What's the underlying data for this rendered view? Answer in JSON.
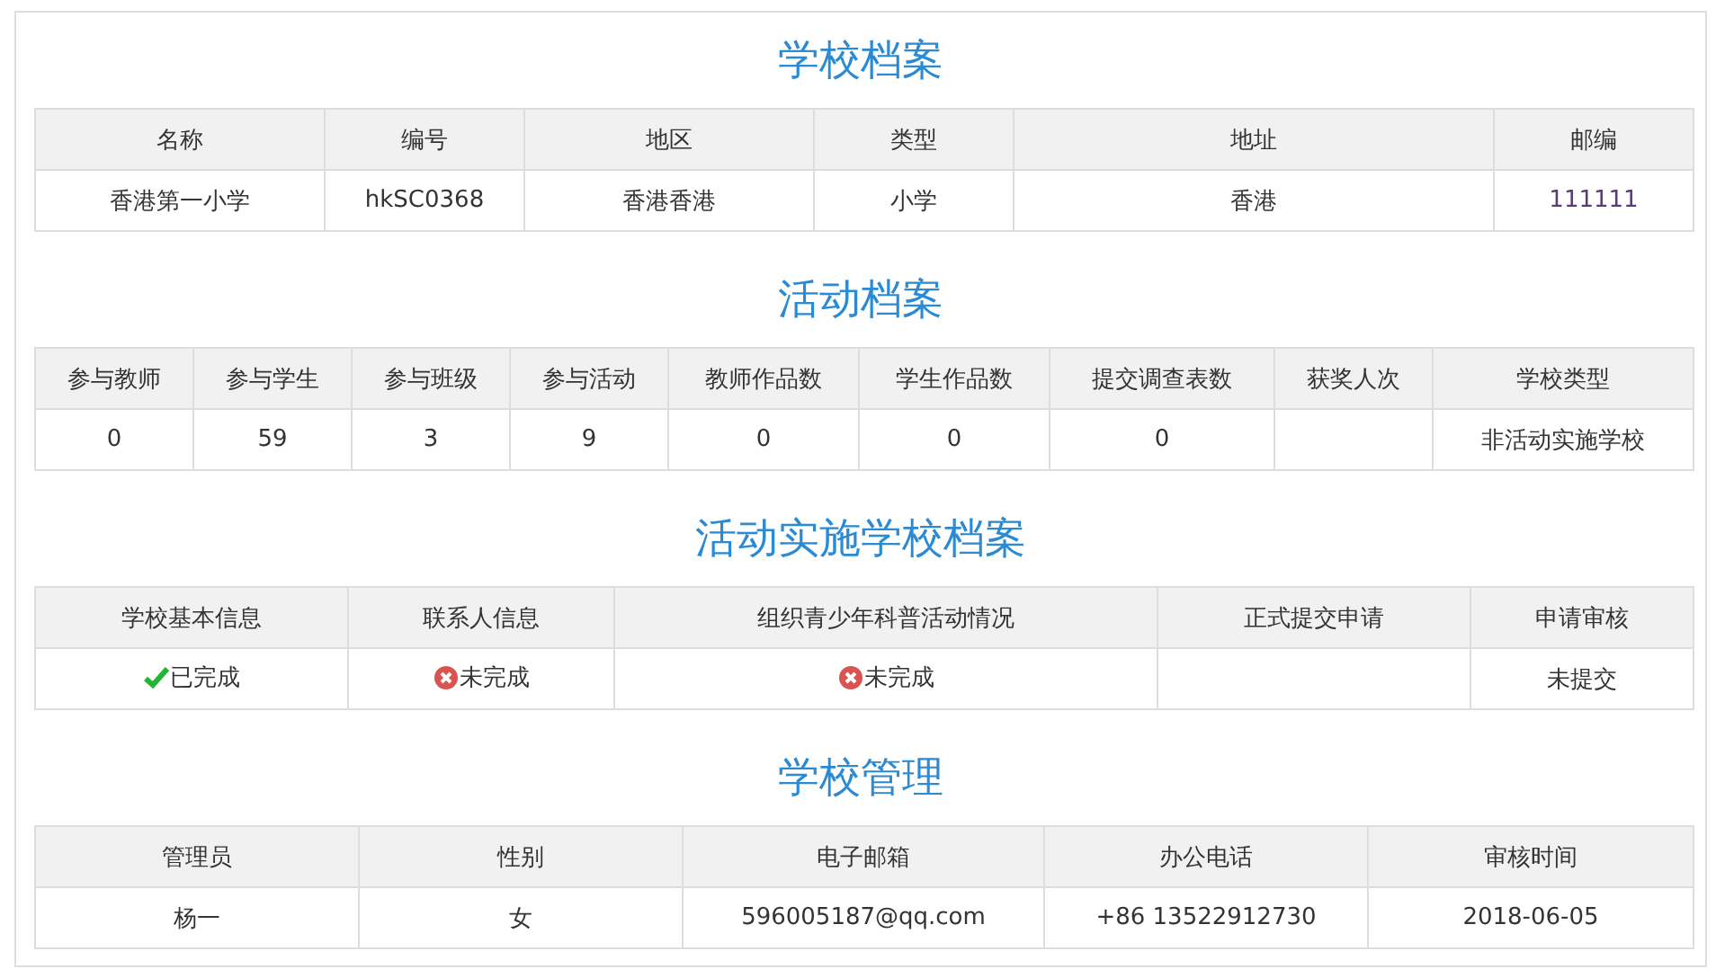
{
  "sections": [
    {
      "title": "学校档案",
      "columns": [
        "名称",
        "编号",
        "地区",
        "类型",
        "地址",
        "邮编"
      ],
      "rows": [
        [
          {
            "text": "香港第一小学"
          },
          {
            "text": "hkSC0368"
          },
          {
            "text": "香港香港"
          },
          {
            "text": "小学"
          },
          {
            "text": "香港"
          },
          {
            "text": "111111",
            "kind": "code"
          }
        ]
      ]
    },
    {
      "title": "活动档案",
      "columns": [
        "参与教师",
        "参与学生",
        "参与班级",
        "参与活动",
        "教师作品数",
        "学生作品数",
        "提交调查表数",
        "获奖人次",
        "学校类型"
      ],
      "rows": [
        [
          {
            "text": "0"
          },
          {
            "text": "59"
          },
          {
            "text": "3"
          },
          {
            "text": "9"
          },
          {
            "text": "0"
          },
          {
            "text": "0"
          },
          {
            "text": "0"
          },
          null,
          {
            "text": "非活动实施学校"
          }
        ]
      ]
    },
    {
      "title": "活动实施学校档案",
      "columns": [
        "学校基本信息",
        "联系人信息",
        "组织青少年科普活动情况",
        "正式提交申请",
        "申请审核"
      ],
      "rows": [
        [
          {
            "text": "已完成",
            "kind": "done"
          },
          {
            "text": "未完成",
            "kind": "pending"
          },
          {
            "text": "未完成",
            "kind": "pending"
          },
          null,
          {
            "text": "未提交"
          }
        ]
      ]
    },
    {
      "title": "学校管理",
      "columns": [
        "管理员",
        "性别",
        "电子邮箱",
        "办公电话",
        "审核时间"
      ],
      "rows": [
        [
          {
            "text": "杨一"
          },
          {
            "text": "女"
          },
          {
            "text": "596005187@qq.com"
          },
          {
            "text": "+86 13522912730"
          },
          {
            "text": "2018-06-05"
          }
        ]
      ]
    }
  ]
}
